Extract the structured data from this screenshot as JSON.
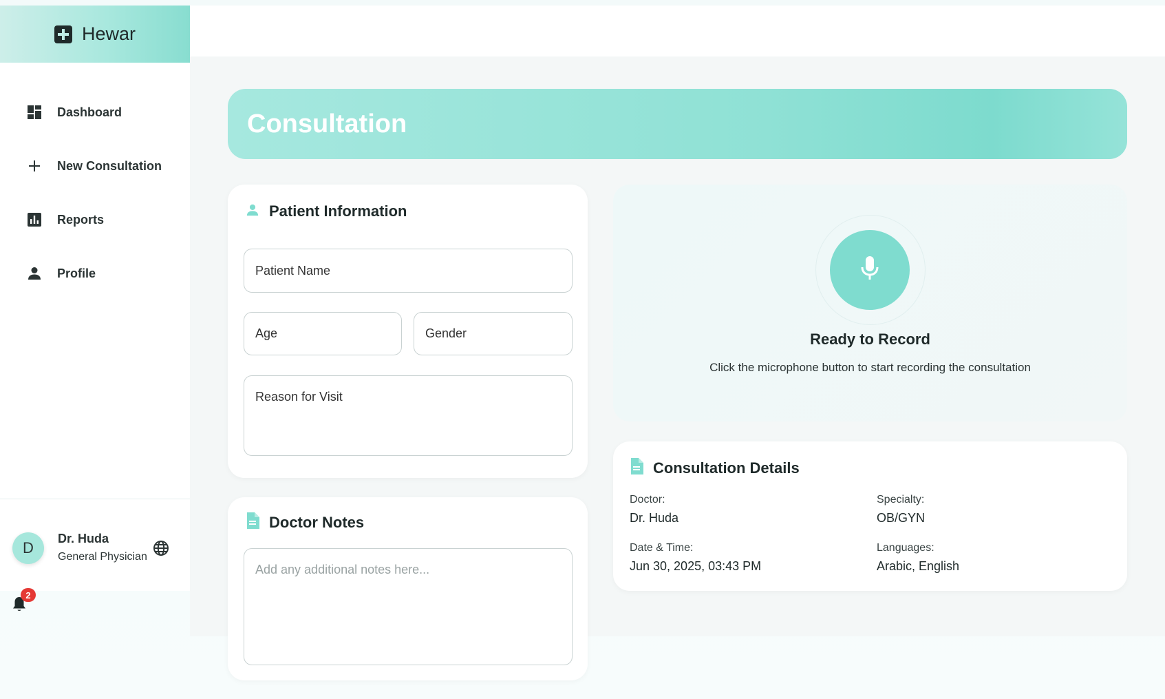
{
  "app": {
    "name": "Hewar"
  },
  "sidebar": {
    "items": [
      {
        "label": "Dashboard",
        "icon": "dashboard-icon"
      },
      {
        "label": "New Consultation",
        "icon": "plus-icon"
      },
      {
        "label": "Reports",
        "icon": "bar-chart-icon"
      },
      {
        "label": "Profile",
        "icon": "person-icon"
      }
    ],
    "user": {
      "initial": "D",
      "name": "Dr. Huda",
      "role": "General Physician"
    },
    "notifications": {
      "count": "2"
    }
  },
  "page": {
    "title": "Consultation"
  },
  "patient_info": {
    "title": "Patient Information",
    "fields": {
      "name": "Patient Name",
      "age": "Age",
      "gender": "Gender",
      "reason": "Reason for Visit"
    }
  },
  "doctor_notes": {
    "title": "Doctor Notes",
    "placeholder": "Add any additional notes here..."
  },
  "recorder": {
    "title": "Ready to Record",
    "subtitle": "Click the microphone button to start recording the consultation"
  },
  "details": {
    "title": "Consultation Details",
    "doctor_label": "Doctor:",
    "doctor": "Dr. Huda",
    "specialty_label": "Specialty:",
    "specialty": "OB/GYN",
    "datetime_label": "Date & Time:",
    "datetime": "Jun 30, 2025, 03:43 PM",
    "languages_label": "Languages:",
    "languages": "Arabic, English"
  },
  "colors": {
    "accent": "#7fdccf",
    "badge": "#e53935"
  }
}
